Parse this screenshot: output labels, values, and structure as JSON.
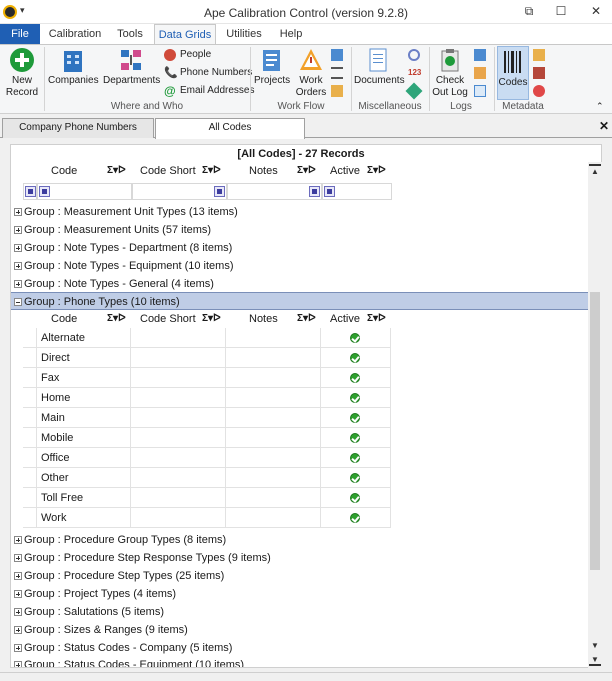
{
  "window": {
    "title": "Ape Calibration Control (version 9.2.8)"
  },
  "ribbon_tabs": [
    {
      "label": "File"
    },
    {
      "label": "Calibration"
    },
    {
      "label": "Tools"
    },
    {
      "label": "Data Grids"
    },
    {
      "label": "Utilities"
    },
    {
      "label": "Help"
    }
  ],
  "ribbon": {
    "new_record": "New\nRecord",
    "companies": "Companies",
    "departments": "Departments",
    "people": "People",
    "phone_numbers": "Phone Numbers",
    "email_addresses": "Email Addresses",
    "group_where_who": "Where and Who",
    "projects": "Projects",
    "work_orders": "Work\nOrders",
    "group_work_flow": "Work Flow",
    "documents": "Documents",
    "group_misc": "Miscellaneous",
    "check_out_log": "Check\nOut Log",
    "group_logs": "Logs",
    "codes": "Codes",
    "group_metadata": "Metadata"
  },
  "doc_tabs": [
    {
      "label": "Company Phone Numbers"
    },
    {
      "label": "All Codes"
    }
  ],
  "grid": {
    "title": "[All Codes] - 27 Records",
    "columns": [
      "Code",
      "Code Short",
      "Notes",
      "Active"
    ],
    "sigma": "Σ",
    "groups_before": [
      "Group : Measurement Unit Types (13 items)",
      "Group : Measurement Units (57 items)",
      "Group : Note Types - Department (8 items)",
      "Group : Note Types - Equipment (10 items)",
      "Group : Note Types - General (4 items)"
    ],
    "expanded_group": "Group : Phone Types (10 items)",
    "rows": [
      "Alternate",
      "Direct",
      "Fax",
      "Home",
      "Main",
      "Mobile",
      "Office",
      "Other",
      "Toll Free",
      "Work"
    ],
    "groups_after": [
      "Group : Procedure Group Types (8 items)",
      "Group : Procedure Step Response Types (9 items)",
      "Group : Procedure Step Types (25 items)",
      "Group : Project Types (4 items)",
      "Group : Salutations (5 items)",
      "Group : Sizes & Ranges (9 items)",
      "Group : Status Codes - Company (5 items)",
      "Group : Status Codes - Equipment (10 items)"
    ]
  }
}
